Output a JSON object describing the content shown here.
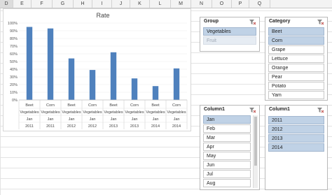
{
  "sheet": {
    "columns": [
      {
        "label": "D",
        "sel": true
      },
      {
        "label": "E",
        "sel": false
      },
      {
        "label": "F",
        "sel": false
      },
      {
        "label": "G",
        "sel": false
      },
      {
        "label": "H",
        "sel": false
      },
      {
        "label": "I",
        "sel": false
      },
      {
        "label": "J",
        "sel": false
      },
      {
        "label": "K",
        "sel": false
      },
      {
        "label": "L",
        "sel": false
      },
      {
        "label": "M",
        "sel": false
      },
      {
        "label": "N",
        "sel": false
      },
      {
        "label": "O",
        "sel": false
      },
      {
        "label": "P",
        "sel": false
      },
      {
        "label": "Q",
        "sel": false
      }
    ]
  },
  "chart_data": {
    "type": "bar",
    "title": "Rate",
    "xlabel": "",
    "ylabel": "",
    "ylim": [
      0,
      100
    ],
    "yticks": [
      "0%",
      "10%",
      "20%",
      "30%",
      "40%",
      "50%",
      "60%",
      "70%",
      "80%",
      "90%",
      "100%"
    ],
    "color": "#4f81bd",
    "categories": [
      {
        "item": "Beet",
        "group": "Vegetables",
        "month": "Jan",
        "year": "2011"
      },
      {
        "item": "Corn",
        "group": "Vegetables",
        "month": "Jan",
        "year": "2011"
      },
      {
        "item": "Beet",
        "group": "Vegetables",
        "month": "Jan",
        "year": "2012"
      },
      {
        "item": "Corn",
        "group": "Vegetables",
        "month": "Jan",
        "year": "2012"
      },
      {
        "item": "Beet",
        "group": "Vegetables",
        "month": "Jan",
        "year": "2013"
      },
      {
        "item": "Corn",
        "group": "Vegetables",
        "month": "Jan",
        "year": "2013"
      },
      {
        "item": "Beet",
        "group": "Vegetables",
        "month": "Jan",
        "year": "2014"
      },
      {
        "item": "Corn",
        "group": "Vegetables",
        "month": "Jan",
        "year": "2014"
      }
    ],
    "values": [
      95,
      93,
      54,
      39,
      62,
      28,
      18,
      41
    ]
  },
  "slicers": {
    "group": {
      "title": "Group",
      "items": [
        {
          "label": "Vegetables",
          "state": "sel"
        },
        {
          "label": "Fruit",
          "state": "dim"
        }
      ]
    },
    "category": {
      "title": "Category",
      "items": [
        {
          "label": "Beet",
          "state": "sel"
        },
        {
          "label": "Corn",
          "state": "sel"
        },
        {
          "label": "Grape",
          "state": "none"
        },
        {
          "label": "Lettuce",
          "state": "none"
        },
        {
          "label": "Orange",
          "state": "none"
        },
        {
          "label": "Pear",
          "state": "none"
        },
        {
          "label": "Potato",
          "state": "none"
        },
        {
          "label": "Yam",
          "state": "none"
        }
      ]
    },
    "month": {
      "title": "Column1",
      "items": [
        {
          "label": "Jan",
          "state": "sel"
        },
        {
          "label": "Feb",
          "state": "none"
        },
        {
          "label": "Mar",
          "state": "none"
        },
        {
          "label": "Apr",
          "state": "none"
        },
        {
          "label": "May",
          "state": "none"
        },
        {
          "label": "Jun",
          "state": "none"
        },
        {
          "label": "Jul",
          "state": "none"
        },
        {
          "label": "Aug",
          "state": "none"
        }
      ]
    },
    "year": {
      "title": "Column1",
      "items": [
        {
          "label": "2011",
          "state": "sel"
        },
        {
          "label": "2012",
          "state": "sel"
        },
        {
          "label": "2013",
          "state": "sel"
        },
        {
          "label": "2014",
          "state": "sel"
        }
      ]
    }
  }
}
